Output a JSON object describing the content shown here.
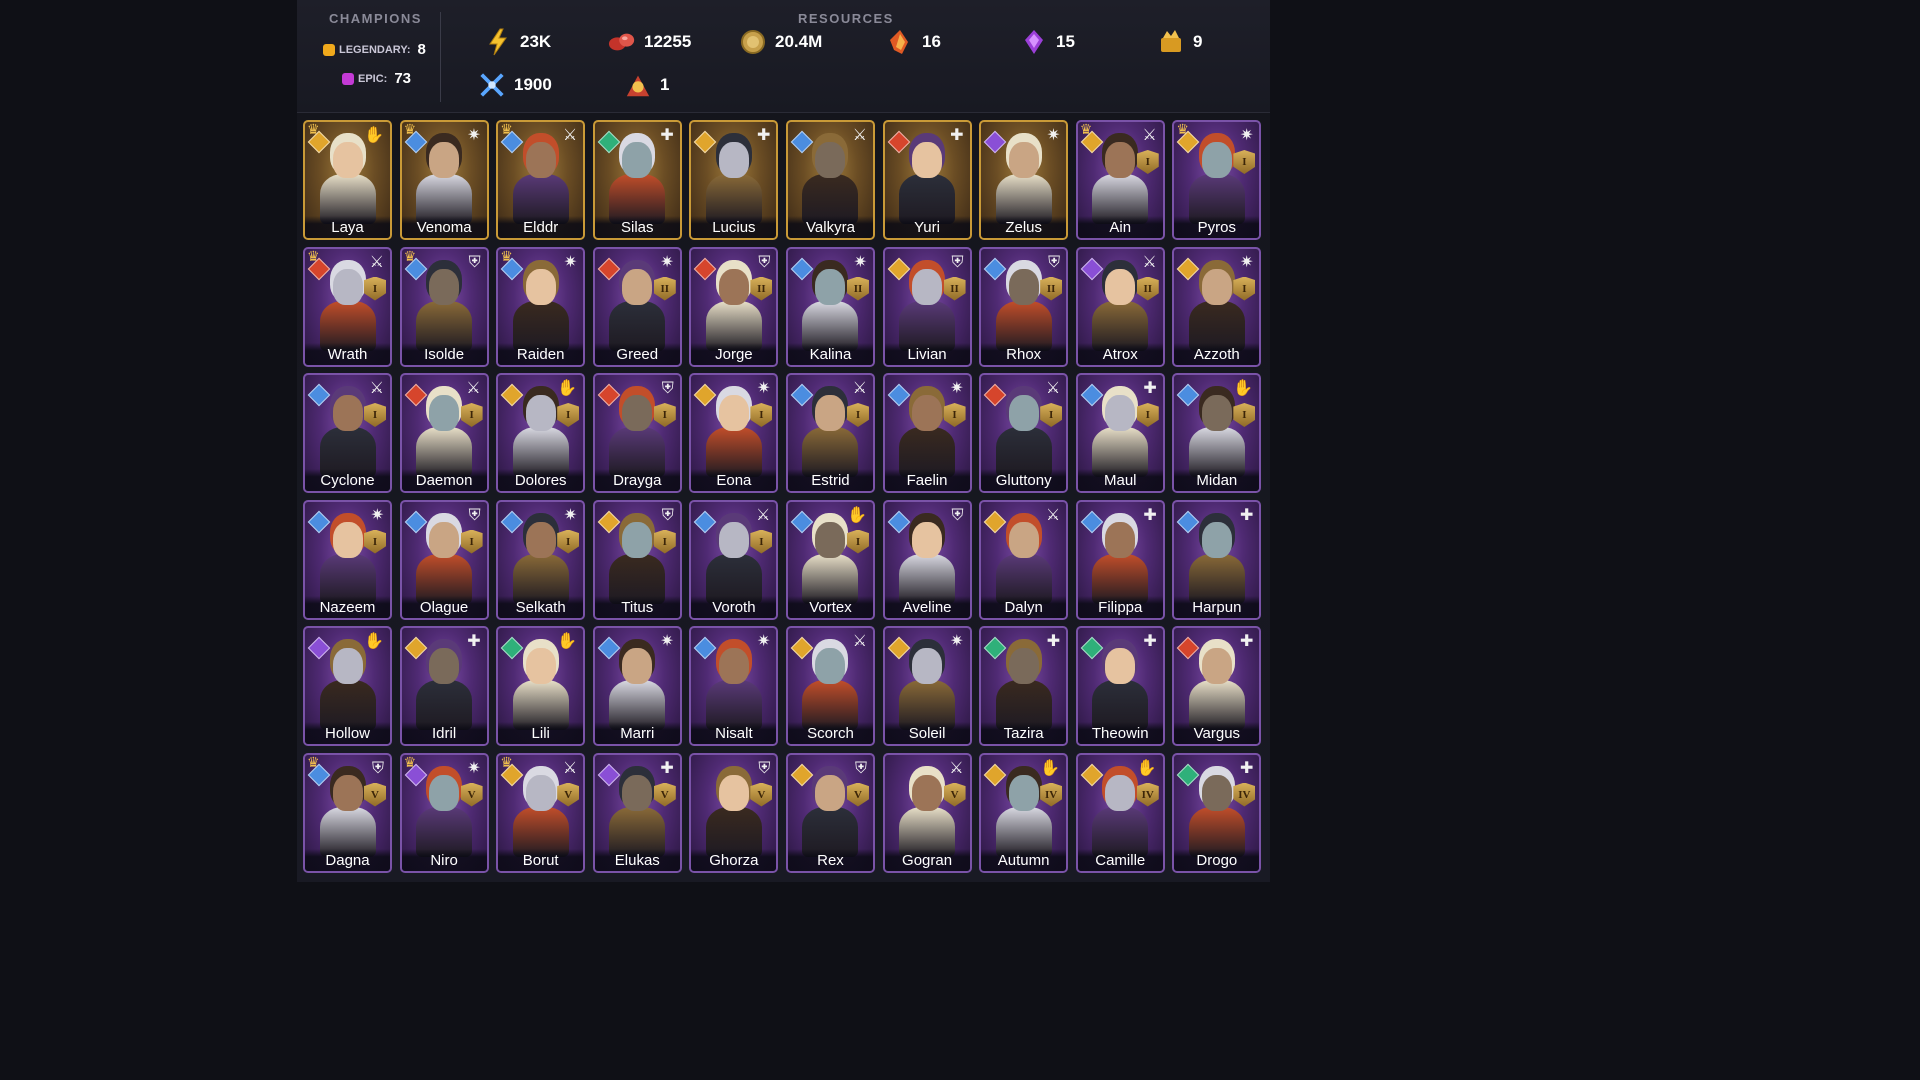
{
  "header": {
    "champions_title": "CHAMPIONS",
    "resources_title": "RESOURCES",
    "legendary_label": "LEGENDARY:",
    "legendary_count": "8",
    "epic_label": "EPIC:",
    "epic_count": "73",
    "legendary_color": "#f0a91c",
    "epic_color": "#c43ad6"
  },
  "resources": [
    {
      "icon": "lightning-icon",
      "value": "23K"
    },
    {
      "icon": "red-gems-icon",
      "value": "12255"
    },
    {
      "icon": "gold-coin-icon",
      "value": "20.4M"
    },
    {
      "icon": "fire-shard-icon",
      "value": "16"
    },
    {
      "icon": "purple-crystal-icon",
      "value": "15"
    },
    {
      "icon": "gold-chest-icon",
      "value": "9"
    },
    {
      "icon": "blue-swords-icon",
      "value": "1900"
    },
    {
      "icon": "summon-scroll-icon",
      "value": "1"
    }
  ],
  "champions": [
    {
      "name": "Laya",
      "rarity": "legendary",
      "crown": true,
      "affinity": "#e0a52c",
      "role": "support",
      "rank": ""
    },
    {
      "name": "Venoma",
      "rarity": "legendary",
      "crown": true,
      "affinity": "#4b8de0",
      "role": "magic",
      "rank": ""
    },
    {
      "name": "Elddr",
      "rarity": "legendary",
      "crown": true,
      "affinity": "#4b8de0",
      "role": "attack",
      "rank": ""
    },
    {
      "name": "Silas",
      "rarity": "legendary",
      "crown": false,
      "affinity": "#2fb07a",
      "role": "hp",
      "rank": ""
    },
    {
      "name": "Lucius",
      "rarity": "legendary",
      "crown": false,
      "affinity": "#e0a52c",
      "role": "hp",
      "rank": ""
    },
    {
      "name": "Valkyra",
      "rarity": "legendary",
      "crown": false,
      "affinity": "#4b8de0",
      "role": "attack",
      "rank": ""
    },
    {
      "name": "Yuri",
      "rarity": "legendary",
      "crown": false,
      "affinity": "#d6452c",
      "role": "hp",
      "rank": ""
    },
    {
      "name": "Zelus",
      "rarity": "legendary",
      "crown": false,
      "affinity": "#8a4fd6",
      "role": "magic",
      "rank": ""
    },
    {
      "name": "Ain",
      "rarity": "epic",
      "crown": true,
      "affinity": "#e0a52c",
      "role": "attack",
      "rank": "I"
    },
    {
      "name": "Pyros",
      "rarity": "epic",
      "crown": true,
      "affinity": "#e0a52c",
      "role": "magic",
      "rank": "I"
    },
    {
      "name": "Wrath",
      "rarity": "epic",
      "crown": true,
      "affinity": "#d6452c",
      "role": "attack",
      "rank": "I"
    },
    {
      "name": "Isolde",
      "rarity": "epic",
      "crown": true,
      "affinity": "#4b8de0",
      "role": "defense",
      "rank": ""
    },
    {
      "name": "Raiden",
      "rarity": "epic",
      "crown": true,
      "affinity": "#4b8de0",
      "role": "magic",
      "rank": ""
    },
    {
      "name": "Greed",
      "rarity": "epic",
      "crown": false,
      "affinity": "#d6452c",
      "role": "magic",
      "rank": "II"
    },
    {
      "name": "Jorge",
      "rarity": "epic",
      "crown": false,
      "affinity": "#d6452c",
      "role": "defense",
      "rank": "II"
    },
    {
      "name": "Kalina",
      "rarity": "epic",
      "crown": false,
      "affinity": "#4b8de0",
      "role": "magic",
      "rank": "II"
    },
    {
      "name": "Livian",
      "rarity": "epic",
      "crown": false,
      "affinity": "#e0a52c",
      "role": "defense",
      "rank": "II"
    },
    {
      "name": "Rhox",
      "rarity": "epic",
      "crown": false,
      "affinity": "#4b8de0",
      "role": "defense",
      "rank": "II"
    },
    {
      "name": "Atrox",
      "rarity": "epic",
      "crown": false,
      "affinity": "#8a4fd6",
      "role": "attack",
      "rank": "II"
    },
    {
      "name": "Azzoth",
      "rarity": "epic",
      "crown": false,
      "affinity": "#e0a52c",
      "role": "magic",
      "rank": "I"
    },
    {
      "name": "Cyclone",
      "rarity": "epic",
      "crown": false,
      "affinity": "#4b8de0",
      "role": "attack",
      "rank": "I"
    },
    {
      "name": "Daemon",
      "rarity": "epic",
      "crown": false,
      "affinity": "#d6452c",
      "role": "attack",
      "rank": "I"
    },
    {
      "name": "Dolores",
      "rarity": "epic",
      "crown": false,
      "affinity": "#e0a52c",
      "role": "support",
      "rank": "I"
    },
    {
      "name": "Drayga",
      "rarity": "epic",
      "crown": false,
      "affinity": "#d6452c",
      "role": "defense",
      "rank": "I"
    },
    {
      "name": "Eona",
      "rarity": "epic",
      "crown": false,
      "affinity": "#e0a52c",
      "role": "magic",
      "rank": "I"
    },
    {
      "name": "Estrid",
      "rarity": "epic",
      "crown": false,
      "affinity": "#4b8de0",
      "role": "attack",
      "rank": "I"
    },
    {
      "name": "Faelin",
      "rarity": "epic",
      "crown": false,
      "affinity": "#4b8de0",
      "role": "magic",
      "rank": "I"
    },
    {
      "name": "Gluttony",
      "rarity": "epic",
      "crown": false,
      "affinity": "#d6452c",
      "role": "attack",
      "rank": "I"
    },
    {
      "name": "Maul",
      "rarity": "epic",
      "crown": false,
      "affinity": "#4b8de0",
      "role": "hp",
      "rank": "I"
    },
    {
      "name": "Midan",
      "rarity": "epic",
      "crown": false,
      "affinity": "#4b8de0",
      "role": "support",
      "rank": "I"
    },
    {
      "name": "Nazeem",
      "rarity": "epic",
      "crown": false,
      "affinity": "#4b8de0",
      "role": "magic",
      "rank": "I"
    },
    {
      "name": "Olague",
      "rarity": "epic",
      "crown": false,
      "affinity": "#4b8de0",
      "role": "defense",
      "rank": "I"
    },
    {
      "name": "Selkath",
      "rarity": "epic",
      "crown": false,
      "affinity": "#4b8de0",
      "role": "magic",
      "rank": "I"
    },
    {
      "name": "Titus",
      "rarity": "epic",
      "crown": false,
      "affinity": "#e0a52c",
      "role": "defense",
      "rank": "I"
    },
    {
      "name": "Voroth",
      "rarity": "epic",
      "crown": false,
      "affinity": "#4b8de0",
      "role": "attack",
      "rank": "I"
    },
    {
      "name": "Vortex",
      "rarity": "epic",
      "crown": false,
      "affinity": "#4b8de0",
      "role": "support",
      "rank": "I"
    },
    {
      "name": "Aveline",
      "rarity": "epic",
      "crown": false,
      "affinity": "#4b8de0",
      "role": "defense",
      "rank": ""
    },
    {
      "name": "Dalyn",
      "rarity": "epic",
      "crown": false,
      "affinity": "#e0a52c",
      "role": "attack",
      "rank": ""
    },
    {
      "name": "Filippa",
      "rarity": "epic",
      "crown": false,
      "affinity": "#4b8de0",
      "role": "hp",
      "rank": ""
    },
    {
      "name": "Harpun",
      "rarity": "epic",
      "crown": false,
      "affinity": "#4b8de0",
      "role": "hp",
      "rank": ""
    },
    {
      "name": "Hollow",
      "rarity": "epic",
      "crown": false,
      "affinity": "#8a4fd6",
      "role": "support",
      "rank": ""
    },
    {
      "name": "Idril",
      "rarity": "epic",
      "crown": false,
      "affinity": "#e0a52c",
      "role": "hp",
      "rank": ""
    },
    {
      "name": "Lili",
      "rarity": "epic",
      "crown": false,
      "affinity": "#2fb07a",
      "role": "support",
      "rank": ""
    },
    {
      "name": "Marri",
      "rarity": "epic",
      "crown": false,
      "affinity": "#4b8de0",
      "role": "magic",
      "rank": ""
    },
    {
      "name": "Nisalt",
      "rarity": "epic",
      "crown": false,
      "affinity": "#4b8de0",
      "role": "magic",
      "rank": ""
    },
    {
      "name": "Scorch",
      "rarity": "epic",
      "crown": false,
      "affinity": "#e0a52c",
      "role": "attack",
      "rank": ""
    },
    {
      "name": "Soleil",
      "rarity": "epic",
      "crown": false,
      "affinity": "#e0a52c",
      "role": "magic",
      "rank": ""
    },
    {
      "name": "Tazira",
      "rarity": "epic",
      "crown": false,
      "affinity": "#2fb07a",
      "role": "hp",
      "rank": ""
    },
    {
      "name": "Theowin",
      "rarity": "epic",
      "crown": false,
      "affinity": "#2fb07a",
      "role": "hp",
      "rank": ""
    },
    {
      "name": "Vargus",
      "rarity": "epic",
      "crown": false,
      "affinity": "#d6452c",
      "role": "hp",
      "rank": ""
    },
    {
      "name": "Dagna",
      "rarity": "epic",
      "crown": true,
      "affinity": "#4b8de0",
      "role": "defense",
      "rank": "V"
    },
    {
      "name": "Niro",
      "rarity": "epic",
      "crown": true,
      "affinity": "#8a4fd6",
      "role": "magic",
      "rank": "V"
    },
    {
      "name": "Borut",
      "rarity": "epic",
      "crown": true,
      "affinity": "#e0a52c",
      "role": "attack",
      "rank": "V"
    },
    {
      "name": "Elukas",
      "rarity": "epic",
      "crown": false,
      "affinity": "#8a4fd6",
      "role": "hp",
      "rank": "V"
    },
    {
      "name": "Ghorza",
      "rarity": "epic",
      "crown": false,
      "affinity": "",
      "role": "defense",
      "rank": "V"
    },
    {
      "name": "Rex",
      "rarity": "epic",
      "crown": false,
      "affinity": "#e0a52c",
      "role": "defense",
      "rank": "V"
    },
    {
      "name": "Gogran",
      "rarity": "epic",
      "crown": false,
      "affinity": "",
      "role": "attack",
      "rank": "V"
    },
    {
      "name": "Autumn",
      "rarity": "epic",
      "crown": false,
      "affinity": "#e0a52c",
      "role": "support",
      "rank": "IV"
    },
    {
      "name": "Camille",
      "rarity": "epic",
      "crown": false,
      "affinity": "#e0a52c",
      "role": "support",
      "rank": "IV"
    },
    {
      "name": "Drogo",
      "rarity": "epic",
      "crown": false,
      "affinity": "#2fb07a",
      "role": "hp",
      "rank": "IV"
    }
  ]
}
